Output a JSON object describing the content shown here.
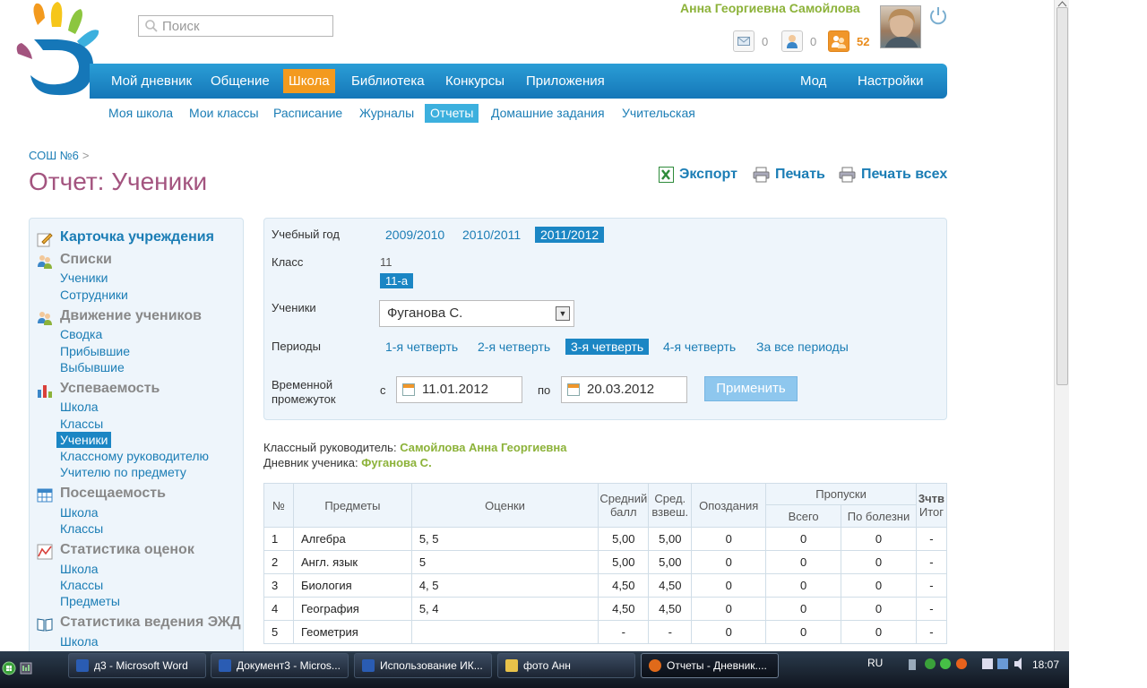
{
  "search": {
    "placeholder": "Поиск"
  },
  "user": {
    "name": "Анна Георгиевна Самойлова"
  },
  "counters": {
    "messages": "0",
    "friends": "0",
    "notifications": "52"
  },
  "main_nav": [
    "Мой дневник",
    "Общение",
    "Школа",
    "Библиотека",
    "Конкурсы",
    "Приложения",
    "Мод",
    "Настройки"
  ],
  "sub_nav": [
    "Моя школа",
    "Мои классы",
    "Расписание",
    "Журналы",
    "Отчеты",
    "Домашние задания",
    "Учительская"
  ],
  "breadcrumb": {
    "school": "СОШ №6",
    "sep": ">"
  },
  "page_title": "Отчет: Ученики",
  "actions": {
    "export": "Экспорт",
    "print": "Печать",
    "print_all": "Печать всех"
  },
  "sidebar": {
    "card": "Карточка учреждения",
    "lists": "Списки",
    "lists_students": "Ученики",
    "lists_staff": "Сотрудники",
    "movement": "Движение учеников",
    "movement_summary": "Сводка",
    "movement_arrived": "Прибывшие",
    "movement_left": "Выбывшие",
    "performance": "Успеваемость",
    "perf_school": "Школа",
    "perf_classes": "Классы",
    "perf_students": "Ученики",
    "perf_class_teacher": "Классному руководителю",
    "perf_subject_teacher": "Учителю по предмету",
    "attendance": "Посещаемость",
    "att_school": "Школа",
    "att_classes": "Классы",
    "grade_stats": "Статистика оценок",
    "gs_school": "Школа",
    "gs_classes": "Классы",
    "gs_subjects": "Предметы",
    "ejd_stats": "Статистика ведения ЭЖД",
    "ejd_school": "Школа"
  },
  "filter": {
    "year_label": "Учебный год",
    "years": [
      "2009/2010",
      "2010/2011",
      "2011/2012"
    ],
    "class_label": "Класс",
    "grade_number": "11",
    "class_name": "11-а",
    "students_label": "Ученики",
    "student_selected": "Фуганова С.",
    "periods_label": "Периоды",
    "periods": [
      "1-я четверть",
      "2-я четверть",
      "3-я четверть",
      "4-я четверть",
      "За все периоды"
    ],
    "range_label_1": "Временной",
    "range_label_2": "промежуток",
    "from_label": "с",
    "from_date": "11.01.2012",
    "to_label": "по",
    "to_date": "20.03.2012",
    "apply": "Применить"
  },
  "info": {
    "teacher_label": "Классный руководитель:",
    "teacher_name": "Самойлова Анна Георгиевна",
    "diary_label": "Дневник ученика:",
    "diary_name": "Фуганова С."
  },
  "table": {
    "headers": {
      "num": "№",
      "subject": "Предметы",
      "grades": "Оценки",
      "avg_1": "Средний",
      "avg_2": "балл",
      "wavg_1": "Сред.",
      "wavg_2": "взвеш.",
      "late": "Опоздания",
      "absences": "Пропуски",
      "abs_total": "Всего",
      "abs_sick": "По болезни",
      "final_1": "3чтв",
      "final_2": "Итог"
    },
    "rows": [
      [
        "1",
        "Алгебра",
        "5, 5",
        "5,00",
        "5,00",
        "0",
        "0",
        "0",
        "-"
      ],
      [
        "2",
        "Англ. язык",
        "5",
        "5,00",
        "5,00",
        "0",
        "0",
        "0",
        "-"
      ],
      [
        "3",
        "Биология",
        "4, 5",
        "4,50",
        "4,50",
        "0",
        "0",
        "0",
        "-"
      ],
      [
        "4",
        "География",
        "5, 4",
        "4,50",
        "4,50",
        "0",
        "0",
        "0",
        "-"
      ],
      [
        "5",
        "Геометрия",
        "",
        "-",
        "-",
        "0",
        "0",
        "0",
        "-"
      ]
    ]
  },
  "taskbar": {
    "items": [
      "д3 - Microsoft Word",
      "Документ3 - Micros...",
      "Использование ИК...",
      "фото Анн",
      "Отчеты - Дневник...."
    ],
    "lang": "RU",
    "time": "18:07"
  },
  "colors": {
    "brand_blue": "#1577b8",
    "accent_orange": "#f39a1e",
    "title_purple": "#a3547f",
    "name_green": "#8cb239"
  }
}
